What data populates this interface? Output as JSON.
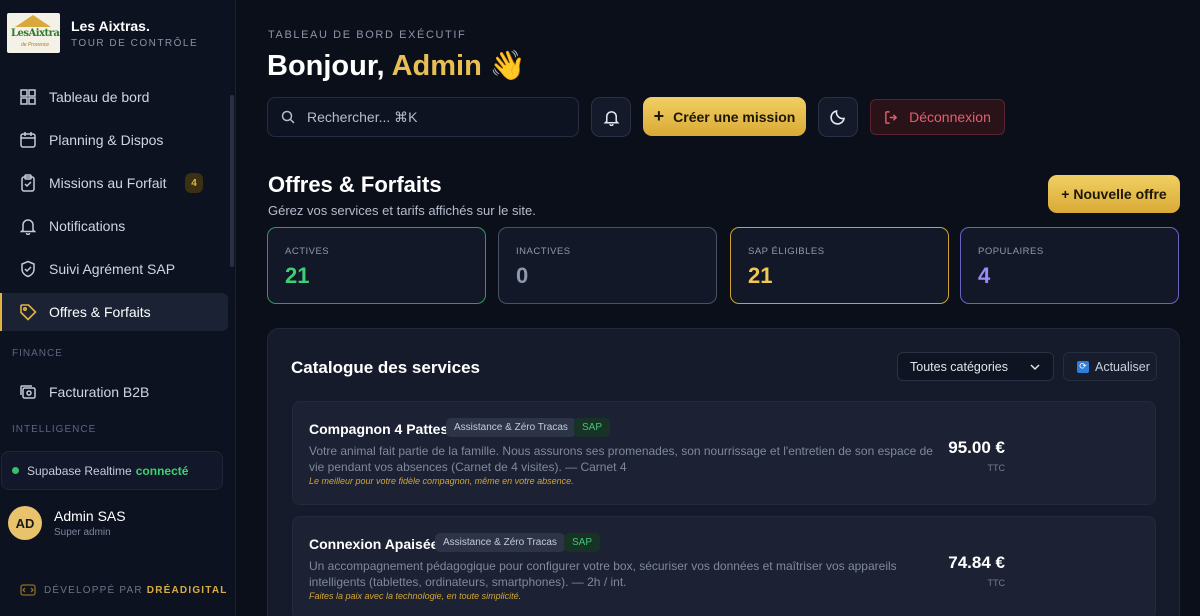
{
  "brand": {
    "name": "Les Aixtras.",
    "subtitle": "TOUR DE CONTRÔLE",
    "logo_text": "Les Aixtras"
  },
  "sidebar": {
    "items": [
      {
        "label": "Tableau de bord",
        "icon": "dashboard-icon"
      },
      {
        "label": "Planning & Dispos",
        "icon": "calendar-icon"
      },
      {
        "label": "Missions au Forfait",
        "icon": "clipboard-icon",
        "badge": "4"
      },
      {
        "label": "Notifications",
        "icon": "bell-icon"
      },
      {
        "label": "Suivi Agrément SAP",
        "icon": "shield-icon"
      },
      {
        "label": "Offres & Forfaits",
        "icon": "tag-icon",
        "active": true
      },
      {
        "label": "Facturation B2B",
        "icon": "invoice-icon"
      }
    ],
    "sections": {
      "finance": "FINANCE",
      "intelligence": "INTELLIGENCE"
    },
    "realtime": {
      "label": "Supabase Realtime",
      "status": "connecté"
    },
    "user": {
      "initials": "AD",
      "name": "Admin SAS",
      "role": "Super admin"
    },
    "footer": {
      "prefix": "DÉVELOPPÉ PAR",
      "brand": "DRÉADIGITAL"
    }
  },
  "header": {
    "kicker": "TABLEAU DE BORD EXÉCUTIF",
    "greeting": "Bonjour,",
    "username": "Admin",
    "emoji": "👋",
    "search_placeholder": "Rechercher... ⌘K",
    "create_label": "Créer une mission",
    "logout_label": "Déconnexion"
  },
  "page": {
    "title": "Offres & Forfaits",
    "subtitle": "Gérez vos services et tarifs affichés sur le site.",
    "new_offer_label": "+ Nouvelle offre"
  },
  "stats": [
    {
      "label": "ACTIVES",
      "value": "21",
      "color": "#3ecf74",
      "border": "#2f9a5a"
    },
    {
      "label": "INACTIVES",
      "value": "0",
      "color": "#8f98ad",
      "border": "#4a5163"
    },
    {
      "label": "SAP ÉLIGIBLES",
      "value": "21",
      "color": "#f0c94e",
      "border": "#c9a233"
    },
    {
      "label": "POPULAIRES",
      "value": "4",
      "color": "#9b8cf5",
      "border": "#6d62c4"
    }
  ],
  "catalog": {
    "title": "Catalogue des services",
    "filter_value": "Toutes catégories",
    "refresh_label": "Actualiser",
    "services": [
      {
        "name": "Compagnon 4 Pattes",
        "category": "Assistance & Zéro Tracas",
        "badge": "SAP",
        "description": "Votre animal fait partie de la famille. Nous assurons ses promenades, son nourrissage et l'entretien de son espace de vie pendant vos absences (Carnet de 4 visites). — Carnet 4",
        "tagline": "Le meilleur pour votre fidèle compagnon, même en votre absence.",
        "price": "95.00 €",
        "price_note": "TTC"
      },
      {
        "name": "Connexion Apaisée",
        "category": "Assistance & Zéro Tracas",
        "badge": "SAP",
        "description": "Un accompagnement pédagogique pour configurer votre box, sécuriser vos données et maîtriser vos appareils intelligents (tablettes, ordinateurs, smartphones). — 2h / int.",
        "tagline": "Faites la paix avec la technologie, en toute simplicité.",
        "price": "74.84 €",
        "price_note": "TTC"
      }
    ]
  }
}
